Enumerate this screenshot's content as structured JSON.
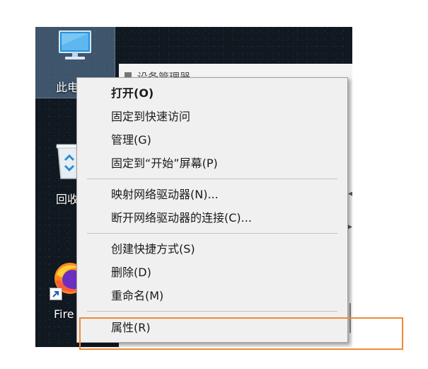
{
  "desktop": {
    "icons": [
      {
        "name": "此电脑",
        "label": "此电",
        "icon": "computer-icon",
        "selected": true
      },
      {
        "name": "回收站",
        "label": "回收",
        "icon": "recycle-bin-icon"
      },
      {
        "name": "Firefox",
        "label": "Fire",
        "icon": "firefox-icon"
      }
    ]
  },
  "background_window": {
    "title": "设备管理器"
  },
  "context_menu": {
    "groups": [
      [
        {
          "label": "打开(O)",
          "bold": true
        },
        {
          "label": "固定到快速访问"
        },
        {
          "label": "管理(G)"
        },
        {
          "label": "固定到“开始”屏幕(P)"
        }
      ],
      [
        {
          "label": "映射网络驱动器(N)..."
        },
        {
          "label": "断开网络驱动器的连接(C)..."
        }
      ],
      [
        {
          "label": "创建快捷方式(S)"
        },
        {
          "label": "删除(D)"
        },
        {
          "label": "重命名(M)"
        }
      ],
      [
        {
          "label": "属性(R)",
          "highlighted": true
        }
      ]
    ]
  },
  "annotation": {
    "highlight_color": "#f08a33",
    "target": "属性(R)"
  }
}
